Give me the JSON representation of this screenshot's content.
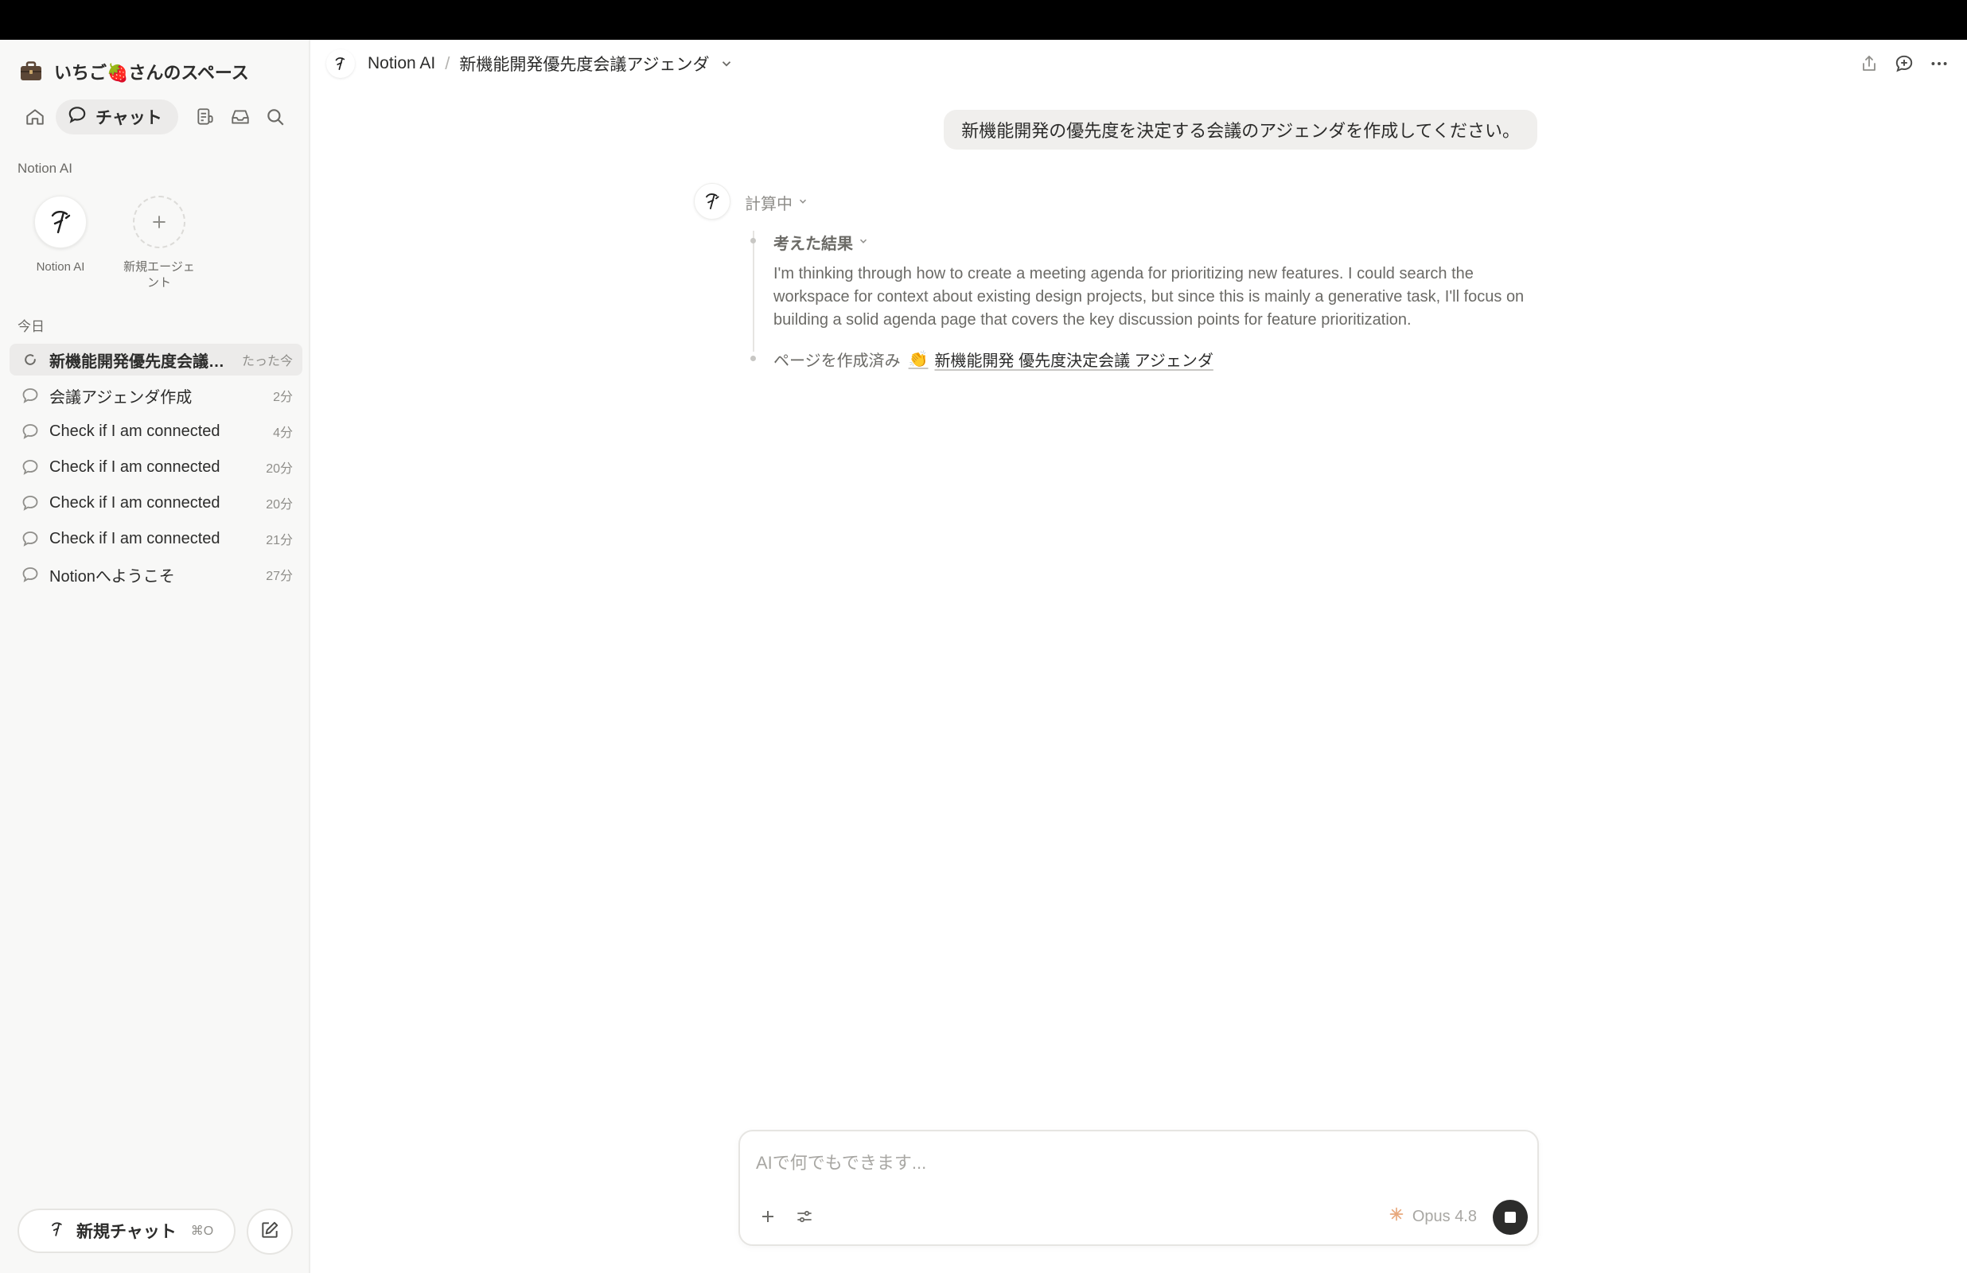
{
  "workspace": {
    "name": "いちご🍓さんのスペース",
    "icon": "briefcase-icon"
  },
  "nav": {
    "chat_label": "チャット"
  },
  "agents_section": {
    "label": "Notion AI",
    "items": [
      {
        "label": "Notion AI",
        "icon": "notion-ai-icon"
      },
      {
        "label": "新規エージェント",
        "icon": "plus-icon"
      }
    ]
  },
  "history": {
    "label": "今日",
    "items": [
      {
        "title": "新機能開発優先度会議アジェンダ",
        "time": "たった今",
        "active": true
      },
      {
        "title": "会議アジェンダ作成",
        "time": "2分"
      },
      {
        "title": "Check if I am connected",
        "time": "4分"
      },
      {
        "title": "Check if I am connected",
        "time": "20分"
      },
      {
        "title": "Check if I am connected",
        "time": "20分"
      },
      {
        "title": "Check if I am connected",
        "time": "21分"
      },
      {
        "title": "Notionへようこそ",
        "time": "27分"
      }
    ]
  },
  "new_chat": {
    "label": "新規チャット",
    "shortcut": "⌘O"
  },
  "header": {
    "breadcrumb_root": "Notion AI",
    "breadcrumb_sep": "/",
    "breadcrumb_current": "新機能開発優先度会議アジェンダ"
  },
  "conversation": {
    "user_message": "新機能開発の優先度を決定する会議のアジェンダを作成してください。",
    "status": "計算中",
    "thought_title": "考えた結果",
    "thought_text": "I'm thinking through how to create a meeting agenda for prioritizing new features. I could search the workspace for context about existing design projects, but since this is mainly a generative task, I'll focus on building a solid agenda page that covers the key discussion points for feature prioritization.",
    "page_created_label": "ページを作成済み",
    "page_icon": "👏",
    "page_link": "新機能開発 優先度決定会議 アジェンダ"
  },
  "composer": {
    "placeholder": "AIで何でもできます...",
    "model": "Opus 4.8"
  },
  "colors": {
    "sidebar_bg": "#f8f8f7",
    "accent_text": "#2c2c2b",
    "muted_text": "#8f8e8a",
    "model_icon": "#e8a87c"
  }
}
